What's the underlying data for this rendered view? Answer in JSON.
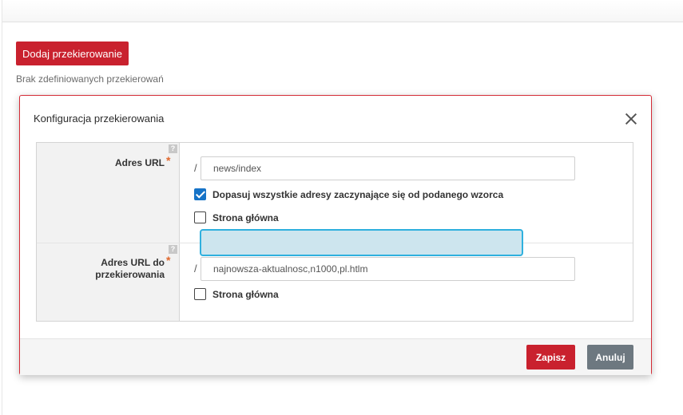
{
  "toolbar": {
    "add_redirect_label": "Dodaj przekierowanie"
  },
  "empty_state": "Brak zdefiniowanych przekierowań",
  "modal": {
    "title": "Konfiguracja przekierowania",
    "source": {
      "label": "Adres URL",
      "required_mark": "*",
      "help": "?",
      "prefix": "/",
      "value": "news/index",
      "match_prefix_label": "Dopasuj wszystkie adresy zaczynające się od podanego wzorca",
      "match_prefix_checked": true,
      "homepage_label": "Strona główna",
      "homepage_checked": false
    },
    "target": {
      "label_line1": "Adres URL do",
      "label_line2": "przekierowania",
      "required_mark": "*",
      "help": "?",
      "prefix": "/",
      "value": "najnowsza-aktualnosc,n1000,pl.htlm",
      "homepage_label": "Strona główna",
      "homepage_checked": false
    },
    "save_label": "Zapisz",
    "cancel_label": "Anuluj"
  },
  "colors": {
    "primary": "#c9212e",
    "secondary": "#6d7880",
    "highlight": "#2fb0de",
    "required": "#e0682d"
  }
}
